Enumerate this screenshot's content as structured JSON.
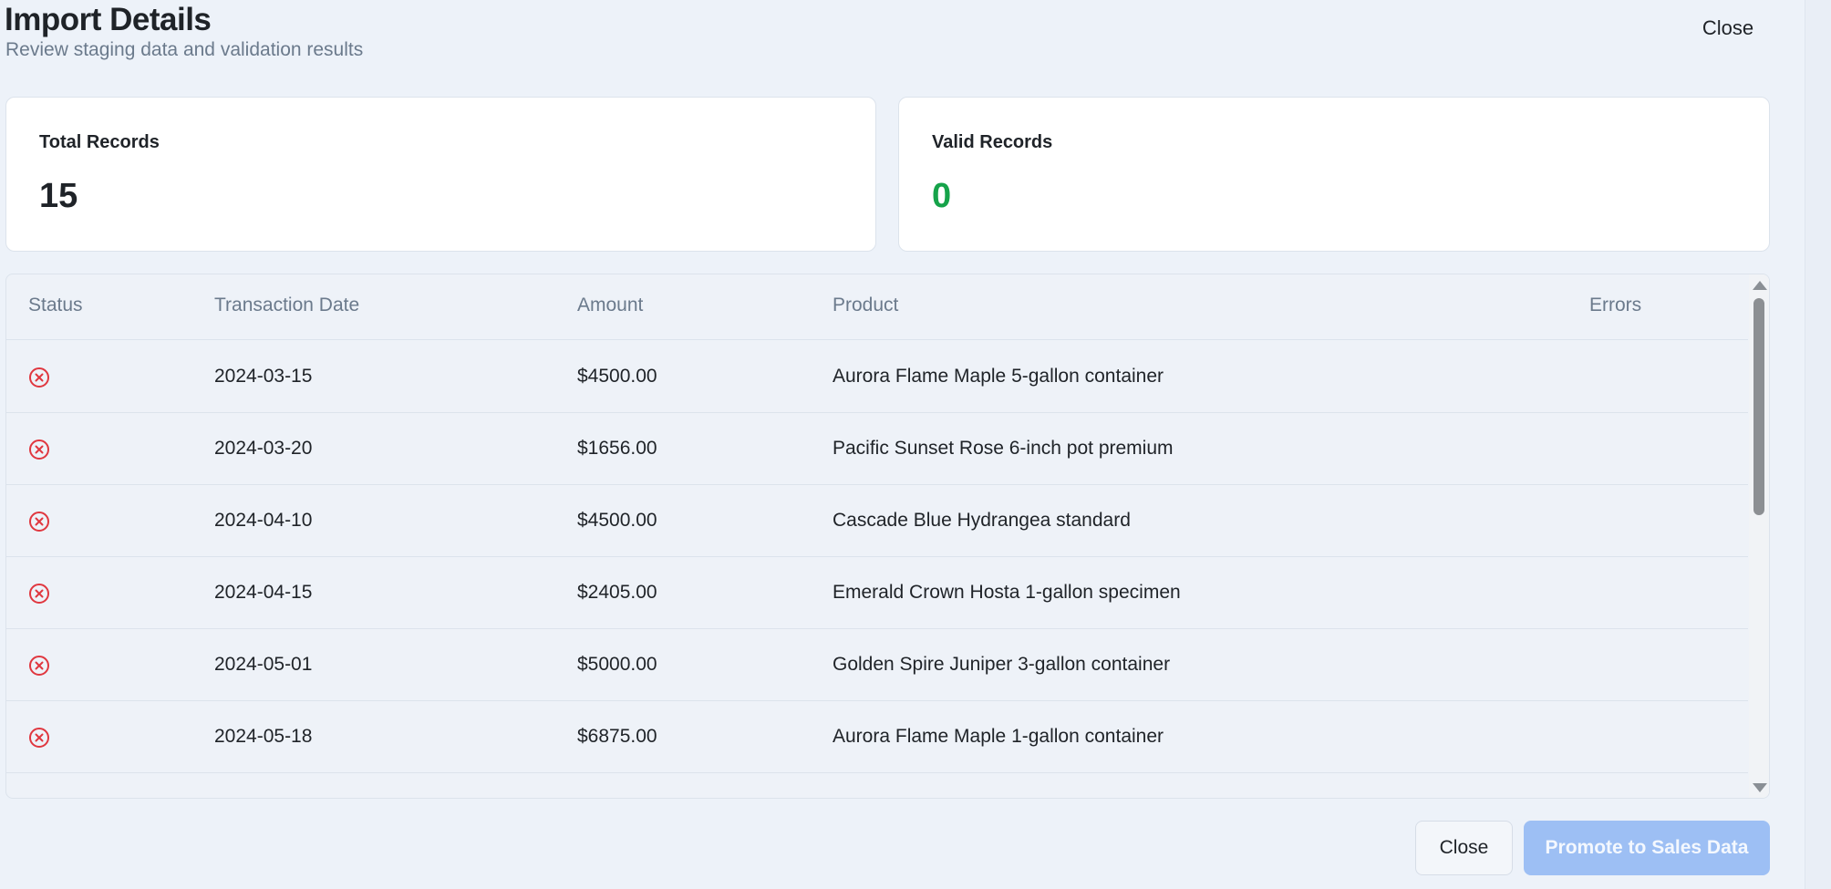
{
  "header": {
    "title": "Import Details",
    "subtitle": "Review staging data and validation results",
    "close_label": "Close"
  },
  "stats": {
    "total_label": "Total Records",
    "total_value": "15",
    "valid_label": "Valid Records",
    "valid_value": "0",
    "valid_color": "#16a34a"
  },
  "table": {
    "columns": [
      "Status",
      "Transaction Date",
      "Amount",
      "Product",
      "Errors"
    ],
    "rows": [
      {
        "status": "error",
        "date": "2024-03-15",
        "amount": "$4500.00",
        "product": "Aurora Flame Maple 5-gallon container",
        "errors": ""
      },
      {
        "status": "error",
        "date": "2024-03-20",
        "amount": "$1656.00",
        "product": "Pacific Sunset Rose 6-inch pot premium",
        "errors": ""
      },
      {
        "status": "error",
        "date": "2024-04-10",
        "amount": "$4500.00",
        "product": "Cascade Blue Hydrangea standard",
        "errors": ""
      },
      {
        "status": "error",
        "date": "2024-04-15",
        "amount": "$2405.00",
        "product": "Emerald Crown Hosta 1-gallon specimen",
        "errors": ""
      },
      {
        "status": "error",
        "date": "2024-05-01",
        "amount": "$5000.00",
        "product": "Golden Spire Juniper 3-gallon container",
        "errors": ""
      },
      {
        "status": "error",
        "date": "2024-05-18",
        "amount": "$6875.00",
        "product": "Aurora Flame Maple 1-gallon container",
        "errors": ""
      }
    ],
    "status_icon": "x-circle-icon",
    "error_color": "#e0373f"
  },
  "footer": {
    "close_label": "Close",
    "promote_label": "Promote to Sales Data",
    "promote_color": "#9dbff4"
  }
}
